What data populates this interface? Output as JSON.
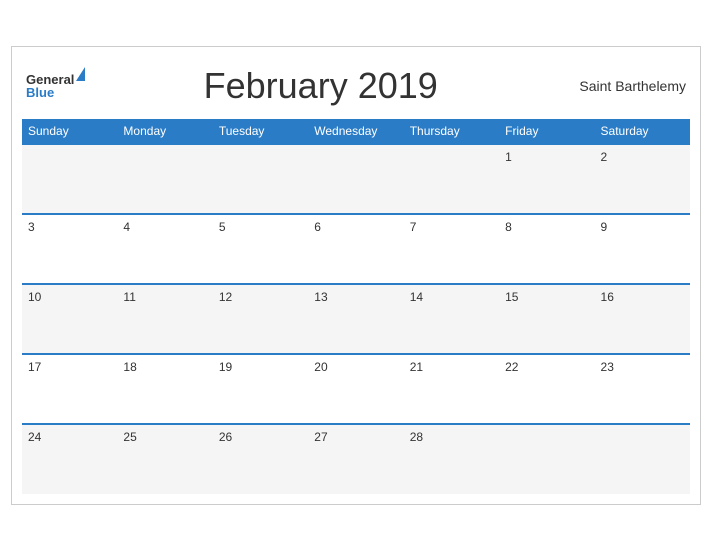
{
  "header": {
    "logo_general": "General",
    "logo_blue": "Blue",
    "title": "February 2019",
    "region": "Saint Barthelemy"
  },
  "days_of_week": [
    "Sunday",
    "Monday",
    "Tuesday",
    "Wednesday",
    "Thursday",
    "Friday",
    "Saturday"
  ],
  "weeks": [
    [
      "",
      "",
      "",
      "",
      "",
      "1",
      "2"
    ],
    [
      "3",
      "4",
      "5",
      "6",
      "7",
      "8",
      "9"
    ],
    [
      "10",
      "11",
      "12",
      "13",
      "14",
      "15",
      "16"
    ],
    [
      "17",
      "18",
      "19",
      "20",
      "21",
      "22",
      "23"
    ],
    [
      "24",
      "25",
      "26",
      "27",
      "28",
      "",
      ""
    ]
  ]
}
